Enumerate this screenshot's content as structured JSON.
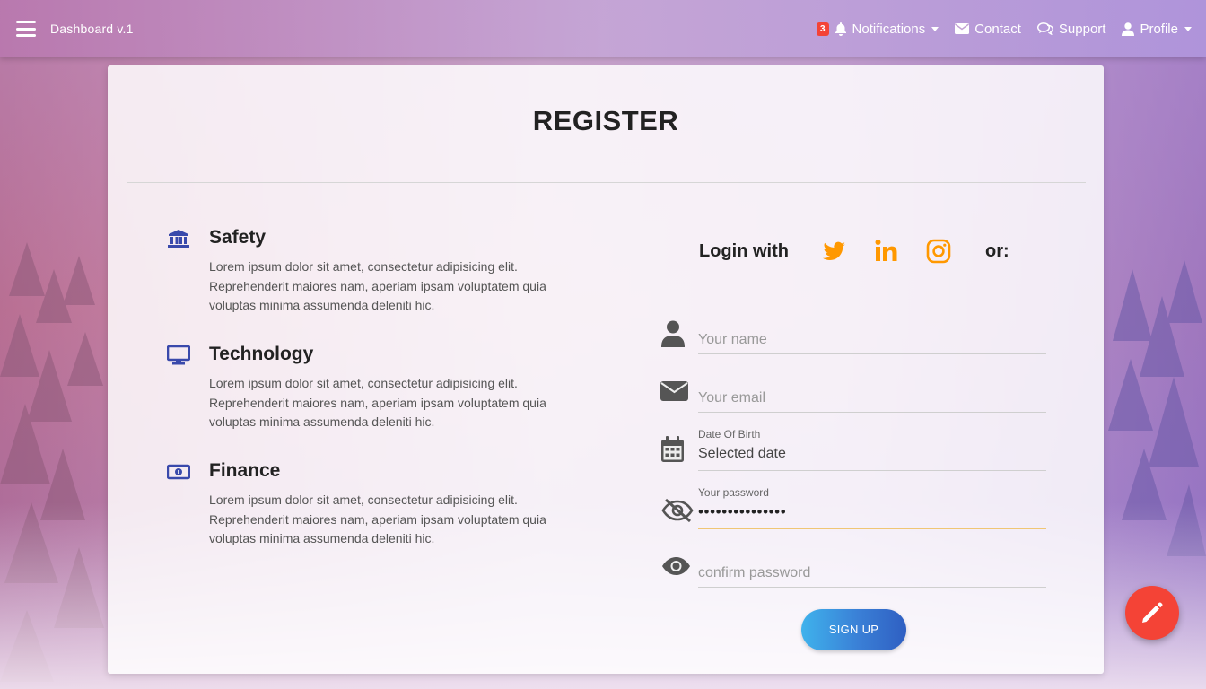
{
  "navbar": {
    "brand": "Dashboard v.1",
    "notifications_count": "3",
    "notifications_label": "Notifications",
    "contact_label": "Contact",
    "support_label": "Support",
    "profile_label": "Profile"
  },
  "register": {
    "title": "REGISTER",
    "features": [
      {
        "icon": "bank-icon",
        "title": "Safety",
        "text": "Lorem ipsum dolor sit amet, consectetur adipisicing elit. Reprehenderit maiores nam, aperiam ipsam voluptatem quia voluptas minima assumenda deleniti hic."
      },
      {
        "icon": "monitor-icon",
        "title": "Technology",
        "text": "Lorem ipsum dolor sit amet, consectetur adipisicing elit. Reprehenderit maiores nam, aperiam ipsam voluptatem quia voluptas minima assumenda deleniti hic."
      },
      {
        "icon": "money-icon",
        "title": "Finance",
        "text": "Lorem ipsum dolor sit amet, consectetur adipisicing elit. Reprehenderit maiores nam, aperiam ipsam voluptatem quia voluptas minima assumenda deleniti hic."
      }
    ],
    "login_with": "Login with",
    "social": [
      "twitter-icon",
      "linkedin-icon",
      "instagram-icon"
    ],
    "or_label": "or:",
    "form": {
      "name_placeholder": "Your name",
      "email_placeholder": "Your email",
      "dob_label": "Date Of Birth",
      "dob_value": "Selected date",
      "password_label": "Your password",
      "password_value": "•••••••••••••••",
      "confirm_placeholder": "confirm password"
    },
    "signup_label": "SIGN UP"
  },
  "colors": {
    "accent": "#3949ab",
    "social": "#ff9800",
    "fab": "#f44336",
    "badge": "#f44336"
  }
}
